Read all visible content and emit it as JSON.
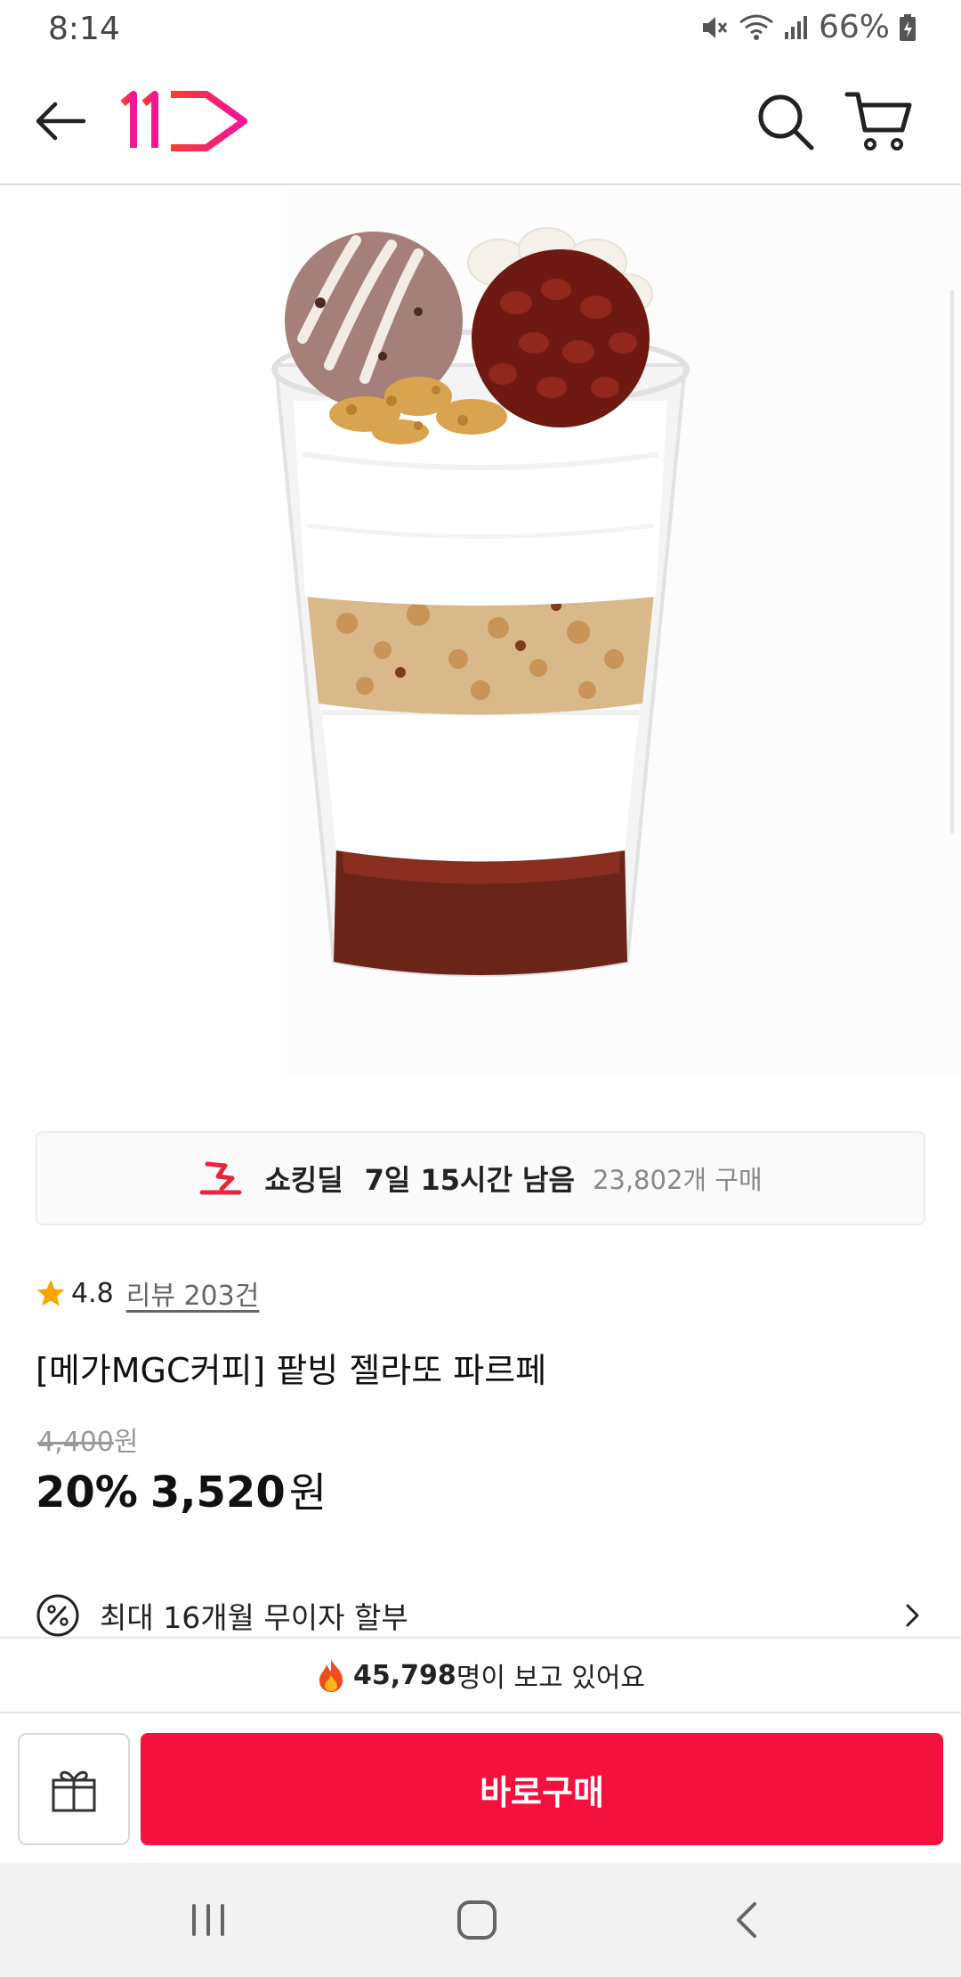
{
  "status_bar": {
    "time": "8:14",
    "battery": "66%"
  },
  "header": {
    "logo_text": "11",
    "icons": [
      "back-arrow-icon",
      "search-icon",
      "cart-icon"
    ]
  },
  "deal": {
    "title": "쇼킹딜",
    "remaining": "7일 15시간 남음",
    "purchase_count": "23,802개 구매"
  },
  "review": {
    "rating": "4.8",
    "label": "리뷰 203건"
  },
  "product": {
    "title": "[메가MGC커피] 팥빙 젤라또 파르페",
    "original_price": "4,400",
    "original_currency": "원",
    "discount_rate": "20%",
    "sale_price": "3,520",
    "sale_currency": "원"
  },
  "installment": {
    "text": "최대 16개월 무이자 할부"
  },
  "viewers": {
    "count": "45,798",
    "text": "명이 보고 있어요"
  },
  "bottom_bar": {
    "buy_label": "바로구매"
  },
  "colors": {
    "accent": "#f5113e",
    "star": "#f7a600",
    "logo_gradient_start": "#ff3a2f",
    "logo_gradient_end": "#f0159a"
  }
}
